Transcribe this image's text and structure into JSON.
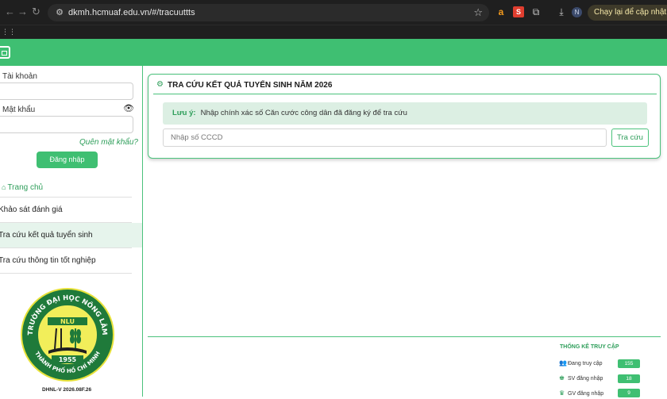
{
  "browser": {
    "url": "dkmh.hcmuaf.edu.vn/#/tracuuttts",
    "update_label": "Chạy lại để cập nhật",
    "profile_initial": "N"
  },
  "sidebar": {
    "account_label": "Tài khoản",
    "password_label": "Mật khẩu",
    "forgot_label": "Quên mật khẩu?",
    "login_label": "Đăng nhập",
    "home_label": "Trang chủ",
    "items": [
      {
        "label": "Khảo sát đánh giá"
      },
      {
        "label": "Tra cứu kết quả tuyển sinh"
      },
      {
        "label": "Tra cứu thông tin tốt nghiệp"
      }
    ],
    "logo_text_top": "TRƯỜNG ĐẠI HỌC NÔNG LÂM",
    "logo_text_bottom": "THÀNH PHỐ HỒ CHÍ MINH",
    "logo_abbr": "NLU",
    "logo_year": "1955",
    "version": "DHNL-V 2026.08F.26"
  },
  "main": {
    "card_title": "TRA CỨU KẾT QUẢ TUYỂN SINH NĂM 2026",
    "note_label": "Lưu ý:",
    "note_text": "Nhập chính xác số Căn cước công dân đã đăng ký để tra cứu",
    "input_placeholder": "Nhập số CCCD",
    "search_label": "Tra cứu"
  },
  "stats": {
    "title": "THỐNG KÊ TRUY CẬP",
    "rows": [
      {
        "label": "Đang truy cập",
        "value": "155"
      },
      {
        "label": "SV đăng nhập",
        "value": "18"
      },
      {
        "label": "GV đăng nhập",
        "value": "9"
      }
    ]
  },
  "colors": {
    "brand_green": "#3fbf72",
    "chrome_dark": "#1f1f1f"
  }
}
